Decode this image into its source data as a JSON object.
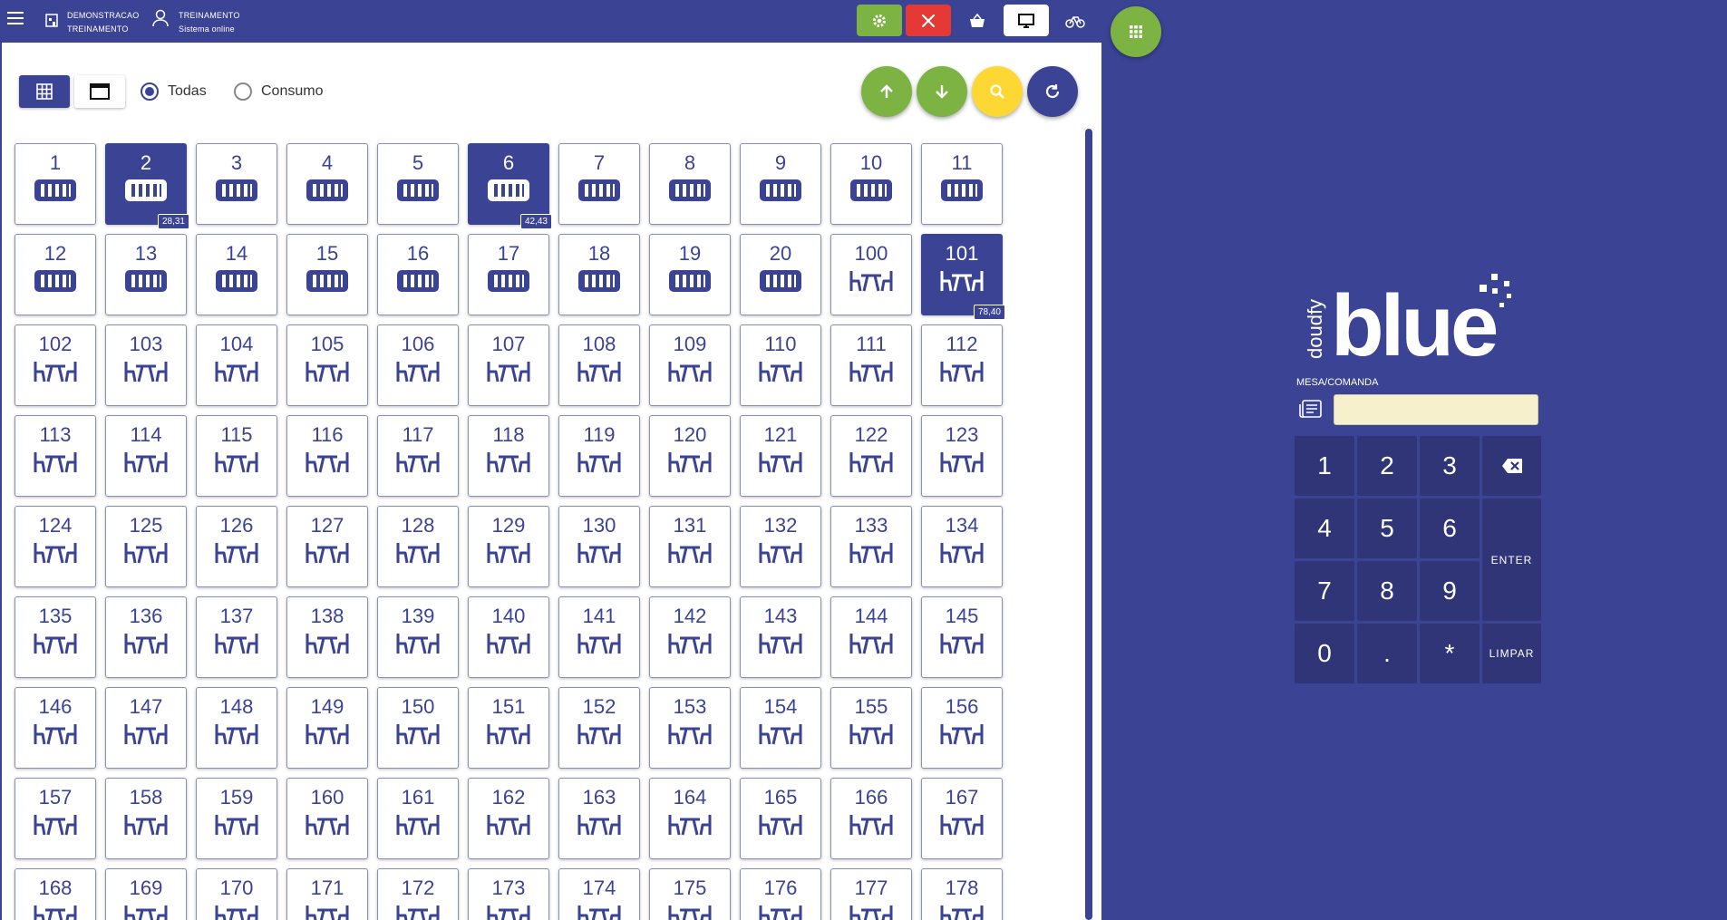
{
  "header": {
    "company_line1": "DEMONSTRACAO",
    "company_line2": "TREINAMENTO",
    "user_name": "TREINAMENTO",
    "user_status": "Sistema online"
  },
  "toolbar": {
    "buttons": [
      {
        "name": "settings-button",
        "icon": "gear-icon",
        "color": "#7cb342"
      },
      {
        "name": "kitchen-button",
        "icon": "utensils-icon",
        "color": "#e53935"
      },
      {
        "name": "basket-button",
        "icon": "basket-icon",
        "color": "#3a4394"
      },
      {
        "name": "monitor-button",
        "icon": "monitor-icon",
        "color": "#ffffff"
      },
      {
        "name": "delivery-button",
        "icon": "bicycle-icon",
        "color": "#3a4394"
      }
    ]
  },
  "filters": {
    "option_all": "Todas",
    "option_consumption": "Consumo",
    "selected": "Todas"
  },
  "tables": [
    {
      "n": "1",
      "type": "comanda"
    },
    {
      "n": "2",
      "type": "comanda",
      "occupied": true,
      "amount": "28,31"
    },
    {
      "n": "3",
      "type": "comanda"
    },
    {
      "n": "4",
      "type": "comanda"
    },
    {
      "n": "5",
      "type": "comanda"
    },
    {
      "n": "6",
      "type": "comanda",
      "occupied": true,
      "amount": "42,43"
    },
    {
      "n": "7",
      "type": "comanda"
    },
    {
      "n": "8",
      "type": "comanda"
    },
    {
      "n": "9",
      "type": "comanda"
    },
    {
      "n": "10",
      "type": "comanda"
    },
    {
      "n": "11",
      "type": "comanda"
    },
    {
      "n": "12",
      "type": "comanda"
    },
    {
      "n": "13",
      "type": "comanda"
    },
    {
      "n": "14",
      "type": "comanda"
    },
    {
      "n": "15",
      "type": "comanda"
    },
    {
      "n": "16",
      "type": "comanda"
    },
    {
      "n": "17",
      "type": "comanda"
    },
    {
      "n": "18",
      "type": "comanda"
    },
    {
      "n": "19",
      "type": "comanda"
    },
    {
      "n": "20",
      "type": "comanda"
    },
    {
      "n": "100",
      "type": "mesa"
    },
    {
      "n": "101",
      "type": "mesa",
      "occupied": true,
      "amount": "78,40"
    },
    {
      "n": "102",
      "type": "mesa"
    },
    {
      "n": "103",
      "type": "mesa"
    },
    {
      "n": "104",
      "type": "mesa"
    },
    {
      "n": "105",
      "type": "mesa"
    },
    {
      "n": "106",
      "type": "mesa"
    },
    {
      "n": "107",
      "type": "mesa"
    },
    {
      "n": "108",
      "type": "mesa"
    },
    {
      "n": "109",
      "type": "mesa"
    },
    {
      "n": "110",
      "type": "mesa"
    },
    {
      "n": "111",
      "type": "mesa"
    },
    {
      "n": "112",
      "type": "mesa"
    },
    {
      "n": "113",
      "type": "mesa"
    },
    {
      "n": "114",
      "type": "mesa"
    },
    {
      "n": "115",
      "type": "mesa"
    },
    {
      "n": "116",
      "type": "mesa"
    },
    {
      "n": "117",
      "type": "mesa"
    },
    {
      "n": "118",
      "type": "mesa"
    },
    {
      "n": "119",
      "type": "mesa"
    },
    {
      "n": "120",
      "type": "mesa"
    },
    {
      "n": "121",
      "type": "mesa"
    },
    {
      "n": "122",
      "type": "mesa"
    },
    {
      "n": "123",
      "type": "mesa"
    },
    {
      "n": "124",
      "type": "mesa"
    },
    {
      "n": "125",
      "type": "mesa"
    },
    {
      "n": "126",
      "type": "mesa"
    },
    {
      "n": "127",
      "type": "mesa"
    },
    {
      "n": "128",
      "type": "mesa"
    },
    {
      "n": "129",
      "type": "mesa"
    },
    {
      "n": "130",
      "type": "mesa"
    },
    {
      "n": "131",
      "type": "mesa"
    },
    {
      "n": "132",
      "type": "mesa"
    },
    {
      "n": "133",
      "type": "mesa"
    },
    {
      "n": "134",
      "type": "mesa"
    },
    {
      "n": "135",
      "type": "mesa"
    },
    {
      "n": "136",
      "type": "mesa"
    },
    {
      "n": "137",
      "type": "mesa"
    },
    {
      "n": "138",
      "type": "mesa"
    },
    {
      "n": "139",
      "type": "mesa"
    },
    {
      "n": "140",
      "type": "mesa"
    },
    {
      "n": "141",
      "type": "mesa"
    },
    {
      "n": "142",
      "type": "mesa"
    },
    {
      "n": "143",
      "type": "mesa"
    },
    {
      "n": "144",
      "type": "mesa"
    },
    {
      "n": "145",
      "type": "mesa"
    },
    {
      "n": "146",
      "type": "mesa"
    },
    {
      "n": "147",
      "type": "mesa"
    },
    {
      "n": "148",
      "type": "mesa"
    },
    {
      "n": "149",
      "type": "mesa"
    },
    {
      "n": "150",
      "type": "mesa"
    },
    {
      "n": "151",
      "type": "mesa"
    },
    {
      "n": "152",
      "type": "mesa"
    },
    {
      "n": "153",
      "type": "mesa"
    },
    {
      "n": "154",
      "type": "mesa"
    },
    {
      "n": "155",
      "type": "mesa"
    },
    {
      "n": "156",
      "type": "mesa"
    },
    {
      "n": "157",
      "type": "mesa"
    },
    {
      "n": "158",
      "type": "mesa"
    },
    {
      "n": "159",
      "type": "mesa"
    },
    {
      "n": "160",
      "type": "mesa"
    },
    {
      "n": "161",
      "type": "mesa"
    },
    {
      "n": "162",
      "type": "mesa"
    },
    {
      "n": "163",
      "type": "mesa"
    },
    {
      "n": "164",
      "type": "mesa"
    },
    {
      "n": "165",
      "type": "mesa"
    },
    {
      "n": "166",
      "type": "mesa"
    },
    {
      "n": "167",
      "type": "mesa"
    },
    {
      "n": "168",
      "type": "mesa"
    },
    {
      "n": "169",
      "type": "mesa"
    },
    {
      "n": "170",
      "type": "mesa"
    },
    {
      "n": "171",
      "type": "mesa"
    },
    {
      "n": "172",
      "type": "mesa"
    },
    {
      "n": "173",
      "type": "mesa"
    },
    {
      "n": "174",
      "type": "mesa"
    },
    {
      "n": "175",
      "type": "mesa"
    },
    {
      "n": "176",
      "type": "mesa"
    },
    {
      "n": "177",
      "type": "mesa"
    },
    {
      "n": "178",
      "type": "mesa"
    }
  ],
  "brand": {
    "logo_small": "doudfy",
    "logo_big": "blue"
  },
  "lookup": {
    "label": "MESA/COMANDA",
    "value": "",
    "placeholder": ""
  },
  "keypad": {
    "k1": "1",
    "k2": "2",
    "k3": "3",
    "k4": "4",
    "k5": "5",
    "k6": "6",
    "k7": "7",
    "k8": "8",
    "k9": "9",
    "k0": "0",
    "kdot": ".",
    "kstar": "*",
    "enter": "ENTER",
    "clear": "LIMPAR"
  },
  "colors": {
    "primary": "#3a4394",
    "green": "#7cb342",
    "red": "#e53935",
    "yellow": "#fdd835",
    "keypad": "#2f3576"
  }
}
